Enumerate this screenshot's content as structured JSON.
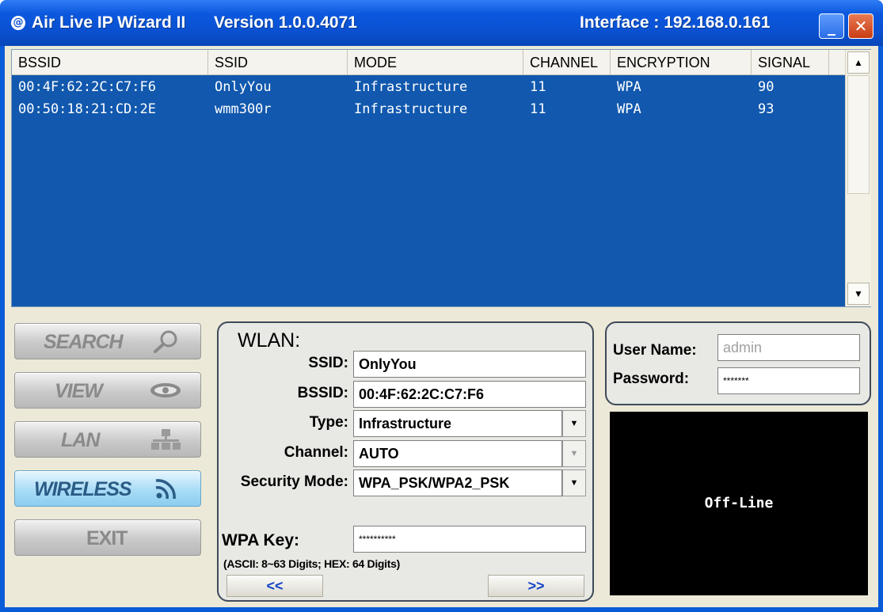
{
  "window": {
    "app_name": "Air Live IP Wizard II",
    "version": "Version 1.0.0.4071",
    "interface": "Interface : 192.168.0.161",
    "icon_glyph": "@",
    "minimize_glyph": "_",
    "close_glyph": "✕"
  },
  "list": {
    "columns": [
      "BSSID",
      "SSID",
      "MODE",
      "CHANNEL",
      "ENCRYPTION",
      "SIGNAL"
    ],
    "rows": [
      [
        "00:4F:62:2C:C7:F6",
        "OnlyYou",
        "Infrastructure",
        "11",
        "WPA",
        "90"
      ],
      [
        "00:50:18:21:CD:2E",
        "wmm300r",
        "Infrastructure",
        "11",
        "WPA",
        "93"
      ]
    ],
    "scroll_up_glyph": "▲",
    "scroll_down_glyph": "▼"
  },
  "nav": {
    "search": {
      "label": "SEARCH",
      "icon": "magnifier-icon"
    },
    "view": {
      "label": "VIEW",
      "icon": "eye-icon"
    },
    "lan": {
      "label": "LAN",
      "icon": "network-icon"
    },
    "wireless": {
      "label": "WIRELESS",
      "icon": "wifi-signal-icon",
      "active": true
    },
    "exit": {
      "label": "EXIT"
    }
  },
  "wlan": {
    "title": "WLAN:",
    "ssid_label": "SSID:",
    "ssid_value": "OnlyYou",
    "bssid_label": "BSSID:",
    "bssid_value": "00:4F:62:2C:C7:F6",
    "type_label": "Type:",
    "type_value": "Infrastructure",
    "channel_label": "Channel:",
    "channel_value": "AUTO",
    "security_label": "Security Mode:",
    "security_value": "WPA_PSK/WPA2_PSK",
    "wpakey_label": "WPA Key:",
    "wpakey_value": "**********",
    "hint": "(ASCII: 8~63 Digits; HEX: 64 Digits)",
    "prev_label": "<<",
    "next_label": ">>",
    "dropdown_glyph": "▼"
  },
  "login": {
    "username_label": "User Name:",
    "username_placeholder": "admin",
    "password_label": "Password:",
    "password_value": "*******"
  },
  "status": {
    "text": "Off-Line"
  },
  "colors": {
    "titlebar": "#0a50d0",
    "list_background": "#1158ae",
    "active_nav": "#a8dcf6",
    "status_background": "#000000"
  }
}
